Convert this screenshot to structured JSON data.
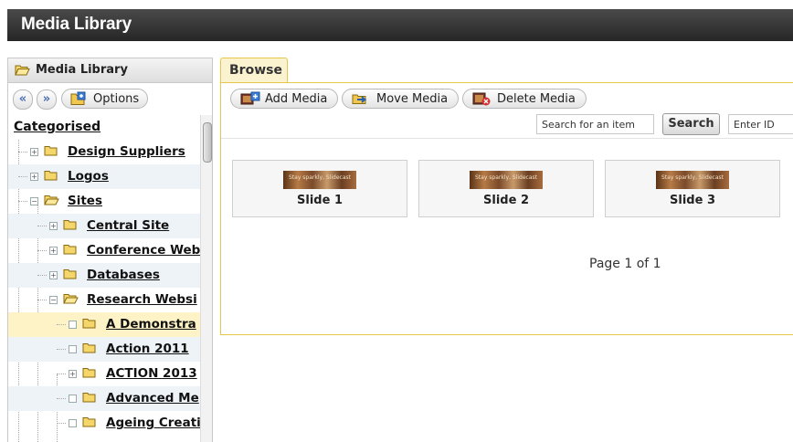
{
  "window": {
    "title": "Media Library"
  },
  "left_panel": {
    "header": "Media Library",
    "nav": {
      "prev": "«",
      "next": "»"
    },
    "options_label": "Options",
    "tree": {
      "root": "Categorised",
      "items": [
        {
          "label": "Design Suppliers",
          "expander": "+"
        },
        {
          "label": "Logos",
          "expander": "+"
        },
        {
          "label": "Sites",
          "expander": "−"
        },
        {
          "label": "Central Site",
          "expander": "+"
        },
        {
          "label": "Conference Web",
          "expander": "+"
        },
        {
          "label": "Databases",
          "expander": "+"
        },
        {
          "label": "Research Websi",
          "expander": "−"
        },
        {
          "label": "A Demonstra",
          "expander": ""
        },
        {
          "label": "Action 2011",
          "expander": ""
        },
        {
          "label": "ACTION 2013",
          "expander": "+"
        },
        {
          "label": "Advanced Me",
          "expander": ""
        },
        {
          "label": "Ageing Creati",
          "expander": ""
        }
      ]
    }
  },
  "browse": {
    "tab_label": "Browse",
    "toolbar": {
      "add_label": "Add Media",
      "move_label": "Move Media",
      "delete_label": "Delete Media"
    },
    "search": {
      "placeholder": "Search for an item",
      "button_label": "Search",
      "id_placeholder": "Enter ID"
    },
    "items": [
      {
        "title": "Slide 1",
        "thumb_text": "Stay sparkly, Slidecast"
      },
      {
        "title": "Slide 2",
        "thumb_text": "Stay sparkly, Slidecast"
      },
      {
        "title": "Slide 3",
        "thumb_text": "Stay sparkly, Slidecast"
      }
    ],
    "pager": "Page 1 of 1"
  },
  "colors": {
    "titlebar": "#333333",
    "tab_bg": "#fbf3d0",
    "tab_border": "#e3c84a",
    "tree_alt_row": "#eef3f8",
    "tree_selected_row": "#fdf3c7"
  }
}
